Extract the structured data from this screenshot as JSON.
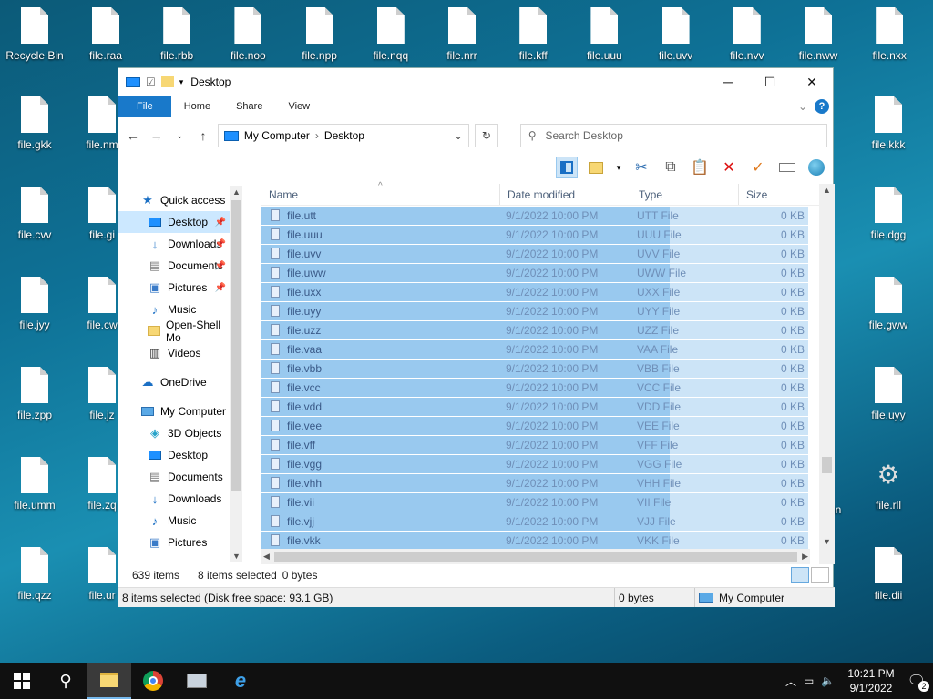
{
  "desktop": {
    "icons_top": [
      "file.raa",
      "file.rbb",
      "file.noo",
      "file.npp",
      "file.nqq",
      "file.nrr",
      "file.kff",
      "file.uuu",
      "file.uvv",
      "file.nvv",
      "file.nww",
      "file.nxx"
    ],
    "recycle_bin": "Recycle Bin",
    "left_col1": [
      "file.gkk",
      "file.cvv",
      "file.jyy",
      "file.zpp",
      "file.umm",
      "file.qzz"
    ],
    "left_col2": [
      "file.nm",
      "file.gi",
      "file.cw",
      "file.jz",
      "file.zq",
      "file.ur"
    ],
    "right_col": [
      "file.kkk",
      "file.dgg",
      "file.gww",
      "file.uyy",
      "file.rll",
      "file.dii"
    ],
    "partial_text": "in"
  },
  "window": {
    "title": "Desktop",
    "tabs": [
      "File",
      "Home",
      "Share",
      "View"
    ],
    "help": "?",
    "breadcrumb": [
      "My Computer",
      "Desktop"
    ],
    "search_placeholder": "Search Desktop"
  },
  "nav": {
    "quick_access": "Quick access",
    "items_qa": [
      {
        "label": "Desktop",
        "icon": "desktop-icon",
        "pinned": true
      },
      {
        "label": "Downloads",
        "icon": "downloads-icon",
        "pinned": true
      },
      {
        "label": "Documents",
        "icon": "documents-icon",
        "pinned": true
      },
      {
        "label": "Pictures",
        "icon": "pictures-icon",
        "pinned": true
      },
      {
        "label": "Music",
        "icon": "music-icon",
        "pinned": false
      },
      {
        "label": "Open-Shell Mo",
        "icon": "folder-icon",
        "pinned": false
      },
      {
        "label": "Videos",
        "icon": "videos-icon",
        "pinned": false
      }
    ],
    "onedrive": "OneDrive",
    "my_computer": "My Computer",
    "items_pc": [
      "3D Objects",
      "Desktop",
      "Documents",
      "Downloads",
      "Music",
      "Pictures"
    ]
  },
  "columns": {
    "name": "Name",
    "date": "Date modified",
    "type": "Type",
    "size": "Size"
  },
  "files": [
    {
      "name": "file.utt",
      "date": "9/1/2022 10:00 PM",
      "type": "UTT File",
      "size": "0 KB"
    },
    {
      "name": "file.uuu",
      "date": "9/1/2022 10:00 PM",
      "type": "UUU File",
      "size": "0 KB"
    },
    {
      "name": "file.uvv",
      "date": "9/1/2022 10:00 PM",
      "type": "UVV File",
      "size": "0 KB"
    },
    {
      "name": "file.uww",
      "date": "9/1/2022 10:00 PM",
      "type": "UWW File",
      "size": "0 KB"
    },
    {
      "name": "file.uxx",
      "date": "9/1/2022 10:00 PM",
      "type": "UXX File",
      "size": "0 KB"
    },
    {
      "name": "file.uyy",
      "date": "9/1/2022 10:00 PM",
      "type": "UYY File",
      "size": "0 KB"
    },
    {
      "name": "file.uzz",
      "date": "9/1/2022 10:00 PM",
      "type": "UZZ File",
      "size": "0 KB"
    },
    {
      "name": "file.vaa",
      "date": "9/1/2022 10:00 PM",
      "type": "VAA File",
      "size": "0 KB"
    },
    {
      "name": "file.vbb",
      "date": "9/1/2022 10:00 PM",
      "type": "VBB File",
      "size": "0 KB"
    },
    {
      "name": "file.vcc",
      "date": "9/1/2022 10:00 PM",
      "type": "VCC File",
      "size": "0 KB"
    },
    {
      "name": "file.vdd",
      "date": "9/1/2022 10:00 PM",
      "type": "VDD File",
      "size": "0 KB"
    },
    {
      "name": "file.vee",
      "date": "9/1/2022 10:00 PM",
      "type": "VEE File",
      "size": "0 KB"
    },
    {
      "name": "file.vff",
      "date": "9/1/2022 10:00 PM",
      "type": "VFF File",
      "size": "0 KB"
    },
    {
      "name": "file.vgg",
      "date": "9/1/2022 10:00 PM",
      "type": "VGG File",
      "size": "0 KB"
    },
    {
      "name": "file.vhh",
      "date": "9/1/2022 10:00 PM",
      "type": "VHH File",
      "size": "0 KB"
    },
    {
      "name": "file.vii",
      "date": "9/1/2022 10:00 PM",
      "type": "VII File",
      "size": "0 KB"
    },
    {
      "name": "file.vjj",
      "date": "9/1/2022 10:00 PM",
      "type": "VJJ File",
      "size": "0 KB"
    },
    {
      "name": "file.vkk",
      "date": "9/1/2022 10:00 PM",
      "type": "VKK File",
      "size": "0 KB"
    }
  ],
  "status": {
    "count": "639 items",
    "selected": "8 items selected",
    "bytes": "0 bytes",
    "bar_left": "8 items selected (Disk free space: 93.1 GB)",
    "bar_mid": "0 bytes",
    "bar_right": "My Computer"
  },
  "taskbar": {
    "time": "10:21 PM",
    "date": "9/1/2022",
    "notifications": "2"
  }
}
